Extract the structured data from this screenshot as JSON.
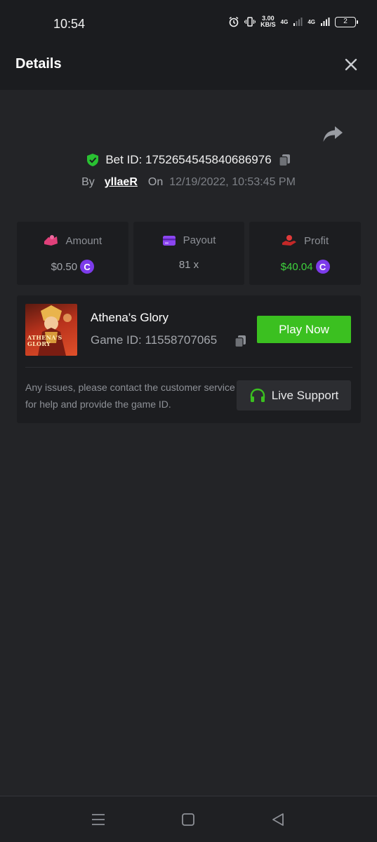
{
  "status_bar": {
    "time": "10:54",
    "net_speed_value": "3.00",
    "net_speed_unit": "KB/S",
    "network_1": "4G",
    "network_2": "4G",
    "battery": "2"
  },
  "header": {
    "title": "Details"
  },
  "bet": {
    "id_text": "Bet ID: 1752654545840686976",
    "by_label": "By",
    "username": "yllaeR",
    "on_label": "On",
    "datetime": "12/19/2022, 10:53:45 PM"
  },
  "stats": [
    {
      "label": "Amount",
      "value": "$0.50",
      "icon": "wallet-hand-icon",
      "has_coin": true
    },
    {
      "label": "Payout",
      "value": "81 x",
      "icon": "card-icon",
      "has_coin": false
    },
    {
      "label": "Profit",
      "value": "$40.04",
      "icon": "money-hand-icon",
      "has_coin": true
    }
  ],
  "game": {
    "name": "Athena's Glory",
    "id_text": "Game ID: 11558707065",
    "thumbnail_text": "ATHENA'S GLORY",
    "play_label": "Play Now",
    "support_note": "Any issues, please contact the customer service for help and provide the game ID.",
    "support_label": "Live Support"
  },
  "coin_glyph": "C",
  "colors": {
    "accent_green": "#3bc020",
    "profit_green": "#3ed23d",
    "coin_purple": "#7c3bea",
    "amount_pink": "#e0407a",
    "payout_purple": "#8b45f0",
    "profit_red": "#e03a3a",
    "verified_green": "#29c132"
  }
}
